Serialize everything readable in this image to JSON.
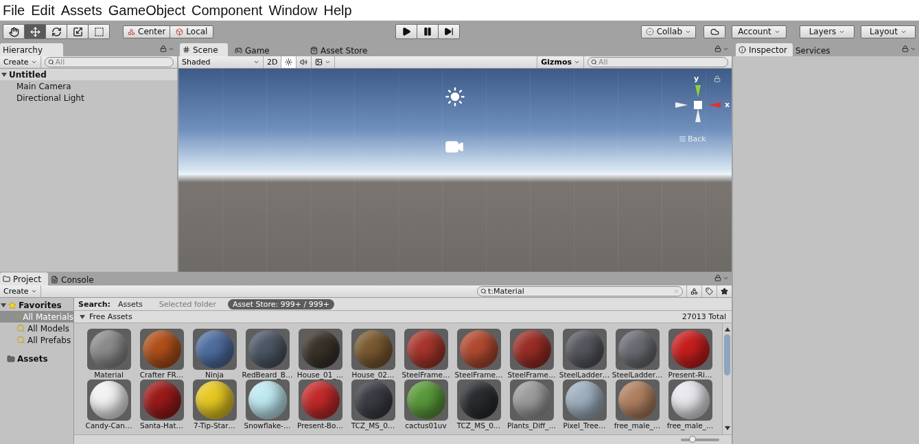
{
  "menu": [
    "File",
    "Edit",
    "Assets",
    "GameObject",
    "Component",
    "Window",
    "Help"
  ],
  "tools": [
    {
      "kind": "hand",
      "selected": false
    },
    {
      "kind": "move",
      "selected": true
    },
    {
      "kind": "rotate",
      "selected": false
    },
    {
      "kind": "scale",
      "selected": false
    },
    {
      "kind": "rect",
      "selected": false
    }
  ],
  "pivot": [
    {
      "kind": "pivot",
      "label": "Center"
    },
    {
      "kind": "rotation",
      "label": "Local"
    }
  ],
  "playback": [
    {
      "kind": "play",
      "selected": false
    },
    {
      "kind": "pause",
      "selected": false
    },
    {
      "kind": "step",
      "selected": false
    }
  ],
  "account_bar": {
    "collab": "Collab",
    "account": "Account",
    "layers": "Layers",
    "layout": "Layout"
  },
  "hierarchy": {
    "tab": "Hierarchy",
    "create": "Create",
    "search_placeholder": "All",
    "scene": {
      "name": "Untitled",
      "expanded": true,
      "children": [
        {
          "name": "Main Camera"
        },
        {
          "name": "Directional Light"
        }
      ]
    }
  },
  "scene_tabs": [
    {
      "label": "Scene",
      "kind": "scene",
      "selected": true
    },
    {
      "label": "Game",
      "kind": "game",
      "selected": false
    },
    {
      "label": "Asset Store",
      "kind": "store",
      "selected": false
    }
  ],
  "scene_toolbar": {
    "shading": "Shaded",
    "mode_2d": "2D",
    "lighting": true,
    "audio": false,
    "gizmos": "Gizmos",
    "search_placeholder": "All"
  },
  "gizmo": {
    "y": "y",
    "x": "x",
    "view": "Back"
  },
  "inspector_tabs": [
    {
      "label": "Inspector",
      "kind": "inspector",
      "selected": true
    },
    {
      "label": "Services",
      "kind": "services",
      "selected": false
    }
  ],
  "project": {
    "tabs": [
      {
        "label": "Project",
        "kind": "project",
        "selected": true
      },
      {
        "label": "Console",
        "kind": "console",
        "selected": false
      }
    ],
    "create": "Create",
    "search": "t:Material",
    "favorites": {
      "name": "Favorites",
      "expanded": true,
      "children": [
        {
          "name": "All Materials",
          "selected": true
        },
        {
          "name": "All Models",
          "selected": false
        },
        {
          "name": "All Prefabs",
          "selected": false
        }
      ]
    },
    "folders": [
      {
        "name": "Assets"
      }
    ],
    "scope_label": "Search:",
    "scopes": [
      {
        "label": "Assets",
        "selected": false
      },
      {
        "label": "Selected folder",
        "selected": false
      },
      {
        "label": "Asset Store: 999+ / 999+",
        "selected": true
      }
    ],
    "section": {
      "name": "Free Assets",
      "expanded": true,
      "total": "27013 Total"
    },
    "assets": [
      {
        "name": "Material",
        "color": "#8c8c8c"
      },
      {
        "name": "Crafter FR…",
        "color": "#b0501a"
      },
      {
        "name": "Ninja",
        "color": "#4f6e9f"
      },
      {
        "name": "RedBeard_B…",
        "color": "#4d5866"
      },
      {
        "name": "House_01_…",
        "color": "#3b332b"
      },
      {
        "name": "House_02…",
        "color": "#7a5a30"
      },
      {
        "name": "SteelFrame…",
        "color": "#a8362c"
      },
      {
        "name": "SteelFrame…",
        "color": "#b24a30"
      },
      {
        "name": "SteelFrame…",
        "color": "#9a2e26"
      },
      {
        "name": "SteelLadder…",
        "color": "#55585e"
      },
      {
        "name": "SteelLadder…",
        "color": "#6a6d73"
      },
      {
        "name": "Present-Ri…",
        "color": "#c81e1e"
      },
      {
        "name": "Candy-Can…",
        "color": "#f2f2f2"
      },
      {
        "name": "Santa-Hat…",
        "color": "#9c1a1a"
      },
      {
        "name": "7-Tip-Star…",
        "color": "#e6c822"
      },
      {
        "name": "Snowflake-…",
        "color": "#bfe9f2"
      },
      {
        "name": "Present-Bo…",
        "color": "#c42a2a"
      },
      {
        "name": "TCZ_MS_0…",
        "color": "#3a3d44"
      },
      {
        "name": "cactus01uv",
        "color": "#5a9a3a"
      },
      {
        "name": "TCZ_MS_0…",
        "color": "#2a2c30"
      },
      {
        "name": "Plants_Diff_…",
        "color": "#9c9c9c"
      },
      {
        "name": "Pixel_Tree…",
        "color": "#9fb0c0"
      },
      {
        "name": "free_male_…",
        "color": "#b08060"
      },
      {
        "name": "free_male_…",
        "color": "#e8e8ee"
      }
    ],
    "zoom": {
      "level": 0.3
    }
  }
}
